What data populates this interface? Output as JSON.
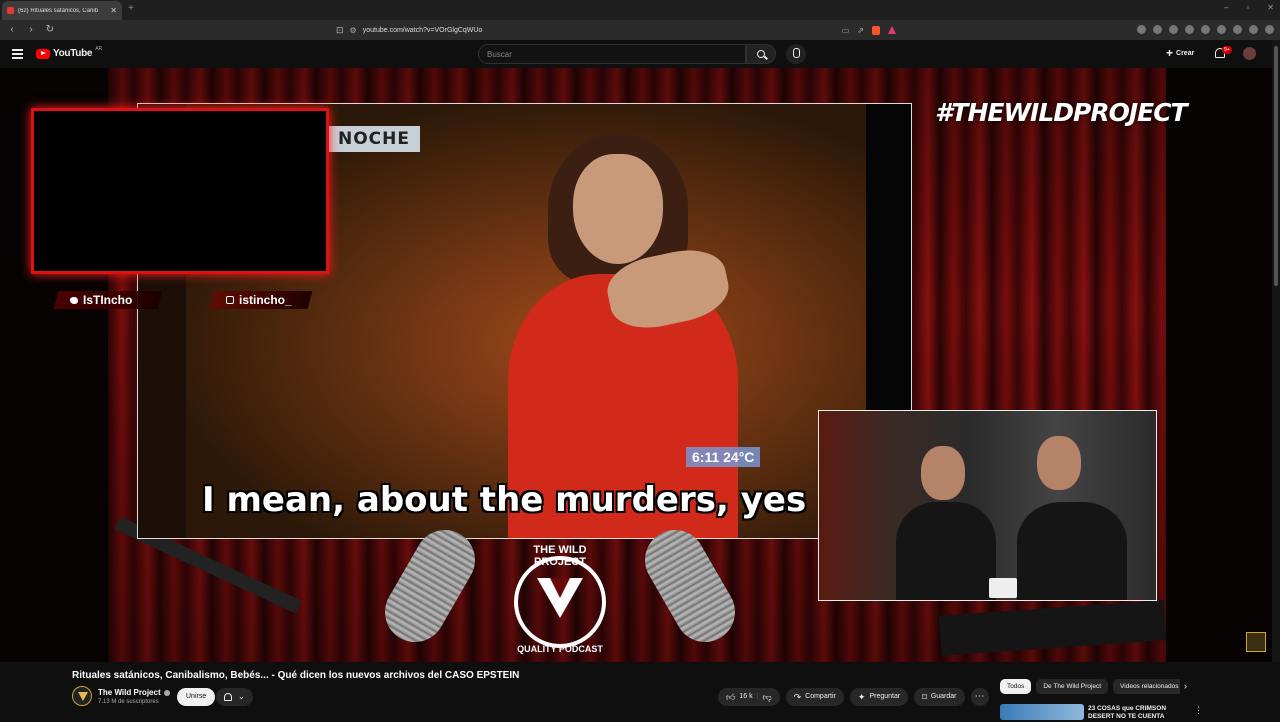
{
  "browser": {
    "tab_title": "(62) Rituales satánicos, Canib",
    "url": "youtube.com/watch?v=VOrGlgCqWUo"
  },
  "youtube": {
    "logo_text": "YouTube",
    "country": "AR",
    "search_placeholder": "Buscar",
    "create_label": "Crear",
    "notif_count": "9+"
  },
  "video": {
    "overlay_brand": "#THEWILDPROJECT",
    "twitter_handle": "IsTIncho",
    "instagram_handle": "istincho_",
    "clip_banner": "NOCHE",
    "clip_weather": "6:11   24°C",
    "subtitle": "I mean, about the murders, yes",
    "logo_top": "THE WILD PROJECT",
    "logo_bottom": "QUALITY PODCAST"
  },
  "info": {
    "title": "Rituales satánicos, Canibalismo, Bebés... - Qué dicen los nuevos archivos del CASO EPSTEIN",
    "channel": "The Wild Project",
    "subscribers": "7.13 M de suscriptores",
    "join_label": "Unirse",
    "likes": "16 k",
    "share_label": "Compartir",
    "ask_label": "Preguntar",
    "save_label": "Guardar"
  },
  "chips": [
    "Todos",
    "De The Wild Project",
    "Videos relacionados"
  ],
  "recommendation": {
    "title": "23 COSAS que CRIMSON DESERT NO TE CUENTA"
  },
  "icons": {
    "like": "thumbs-up-icon",
    "dislike": "thumbs-down-icon",
    "share": "share-icon",
    "ask": "sparkle-icon",
    "save": "bookmark-icon"
  }
}
